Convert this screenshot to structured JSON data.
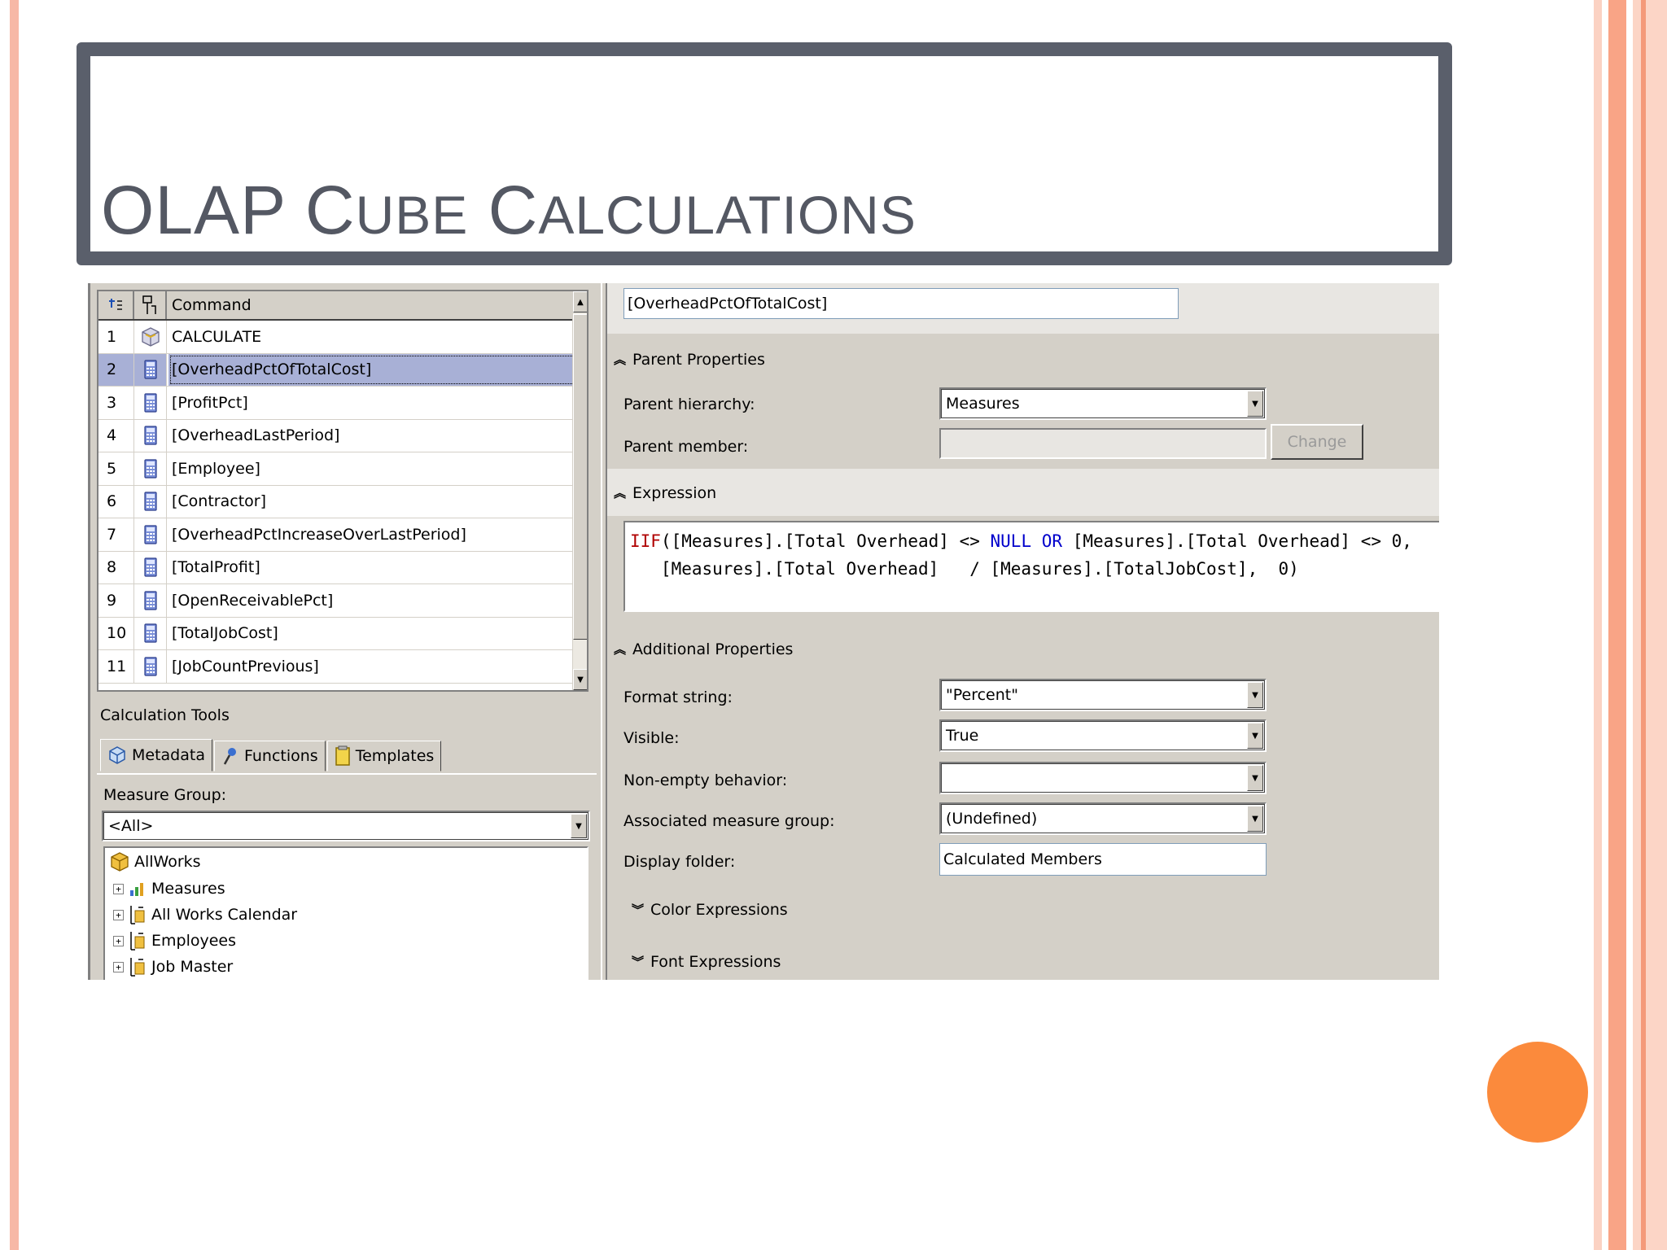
{
  "slide": {
    "title_first": "OLAP C",
    "title_sc1": "UBE",
    "title_space": " C",
    "title_sc2": "ALCULATIONS"
  },
  "grid": {
    "header_command": "Command",
    "rows": [
      {
        "num": "1",
        "command": "CALCULATE",
        "icon": "cube-icon"
      },
      {
        "num": "2",
        "command": "[OverheadPctOfTotalCost]",
        "icon": "calculator-icon"
      },
      {
        "num": "3",
        "command": "[ProfitPct]",
        "icon": "calculator-icon"
      },
      {
        "num": "4",
        "command": "[OverheadLastPeriod]",
        "icon": "calculator-icon"
      },
      {
        "num": "5",
        "command": "[Employee]",
        "icon": "calculator-icon"
      },
      {
        "num": "6",
        "command": "[Contractor]",
        "icon": "calculator-icon"
      },
      {
        "num": "7",
        "command": "[OverheadPctIncreaseOverLastPeriod]",
        "icon": "calculator-icon"
      },
      {
        "num": "8",
        "command": "[TotalProfit]",
        "icon": "calculator-icon"
      },
      {
        "num": "9",
        "command": "[OpenReceivablePct]",
        "icon": "calculator-icon"
      },
      {
        "num": "10",
        "command": "[TotalJobCost]",
        "icon": "calculator-icon"
      },
      {
        "num": "11",
        "command": "[JobCountPrevious]",
        "icon": "calculator-icon"
      }
    ]
  },
  "tools": {
    "title": "Calculation Tools",
    "tabs": [
      "Metadata",
      "Functions",
      "Templates"
    ],
    "measure_group_label": "Measure Group:",
    "measure_group_value": "<All>",
    "tree": [
      "AllWorks",
      "Measures",
      "All Works Calendar",
      "Employees",
      "Job Master"
    ]
  },
  "props": {
    "name": "[OverheadPctOfTotalCost]",
    "parent_section": "Parent Properties",
    "parent_hierarchy_label": "Parent hierarchy:",
    "parent_hierarchy_value": "Measures",
    "parent_member_label": "Parent member:",
    "change_label": "Change",
    "expression_section": "Expression",
    "expr": {
      "l1_a": "IIF",
      "l1_b": "([Measures].[Total Overhead] <> ",
      "l1_c": "NULL",
      "l1_d": " ",
      "l1_e": "OR",
      "l1_f": " [Measures].[Total Overhead] <> 0,",
      "l2": "   [Measures].[Total Overhead]   / [Measures].[TotalJobCost],  0)"
    },
    "additional_section": "Additional Properties",
    "format_label": "Format string:",
    "format_value": "\"Percent\"",
    "visible_label": "Visible:",
    "visible_value": "True",
    "nonempty_label": "Non-empty behavior:",
    "nonempty_value": "",
    "assoc_label": "Associated measure group:",
    "assoc_value": "(Undefined)",
    "folder_label": "Display folder:",
    "folder_value": "Calculated Members",
    "color_section": "Color Expressions",
    "font_section": "Font Expressions"
  }
}
